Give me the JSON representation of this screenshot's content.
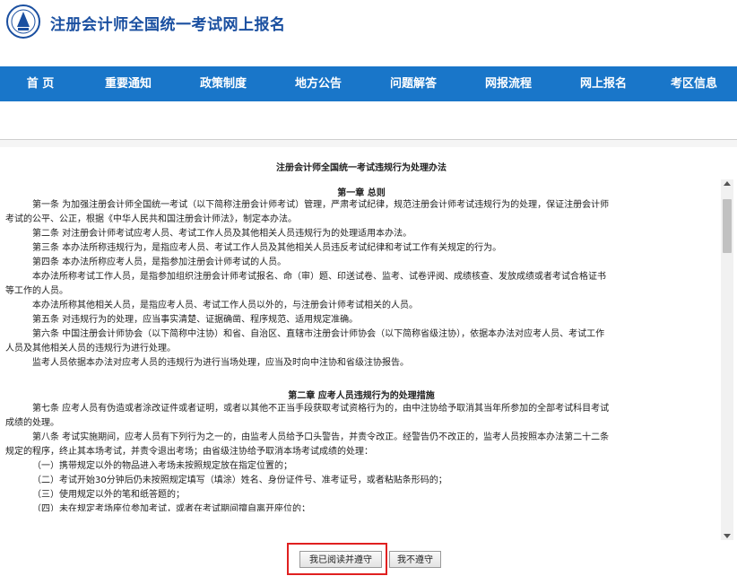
{
  "site": {
    "title": "注册会计师全国统一考试网上报名",
    "logo_icon": "cicpa-seal-icon"
  },
  "nav": [
    {
      "label": "首 页"
    },
    {
      "label": "重要通知"
    },
    {
      "label": "政策制度"
    },
    {
      "label": "地方公告"
    },
    {
      "label": "问题解答"
    },
    {
      "label": "网报流程"
    },
    {
      "label": "网上报名"
    },
    {
      "label": "考区信息"
    }
  ],
  "document": {
    "title": "注册会计师全国统一考试违规行为处理办法",
    "chapter1": "第一章 总则",
    "chapter2": "第二章 应考人员违规行为的处理措施",
    "lines": [
      "第一条 为加强注册会计师全国统一考试（以下简称注册会计师考试）管理，严肃考试纪律，规范注册会计师考试违规行为的处理，保证注册会计师",
      "考试的公平、公正，根据《中华人民共和国注册会计师法》，制定本办法。",
      "第二条 对注册会计师考试应考人员、考试工作人员及其他相关人员违规行为的处理适用本办法。",
      "第三条 本办法所称违规行为，是指应考人员、考试工作人员及其他相关人员违反考试纪律和考试工作有关规定的行为。",
      "第四条 本办法所称应考人员，是指参加注册会计师考试的人员。",
      "本办法所称考试工作人员，是指参加组织注册会计师考试报名、命（审）题、印送试卷、监考、试卷评阅、成绩核查、发放成绩或者考试合格证书",
      "等工作的人员。",
      "本办法所称其他相关人员，是指应考人员、考试工作人员以外的，与注册会计师考试相关的人员。",
      "第五条 对违规行为的处理，应当事实清楚、证据确凿、程序规范、适用规定准确。",
      "第六条 中国注册会计师协会（以下简称中注协）和省、自治区、直辖市注册会计师协会（以下简称省级注协），依据本办法对应考人员、考试工作",
      "人员及其他相关人员的违规行为进行处理。",
      "监考人员依据本办法对应考人员的违规行为进行当场处理，应当及时向中注协和省级注协报告。"
    ],
    "lines2": [
      "第七条 应考人员有伪造或者涂改证件或者证明，或者以其他不正当手段获取考试资格行为的，由中注协给予取消其当年所参加的全部考试科目考试",
      "成绩的处理。",
      "第八条 考试实施期间，应考人员有下列行为之一的，由监考人员给予口头警告，并责令改正。经警告仍不改正的，监考人员按照本办法第二十二条",
      "规定的程序，终止其本场考试，并责令退出考场；由省级注协给予取消本场考试成绩的处理：",
      "（一）携带规定以外的物品进入考场未按照规定放在指定位置的；",
      "（二）考试开始30分钟后仍未按照规定填写（填涂）姓名、身份证件号、准考证号，或者粘贴条形码的；",
      "（三）使用规定以外的笔和纸答题的；",
      "（四）未在规定考场座位参加考试，或者在考试期间擅自离开座位的；"
    ]
  },
  "buttons": {
    "agree": "我已阅读并遵守",
    "disagree": "我不遵守"
  }
}
